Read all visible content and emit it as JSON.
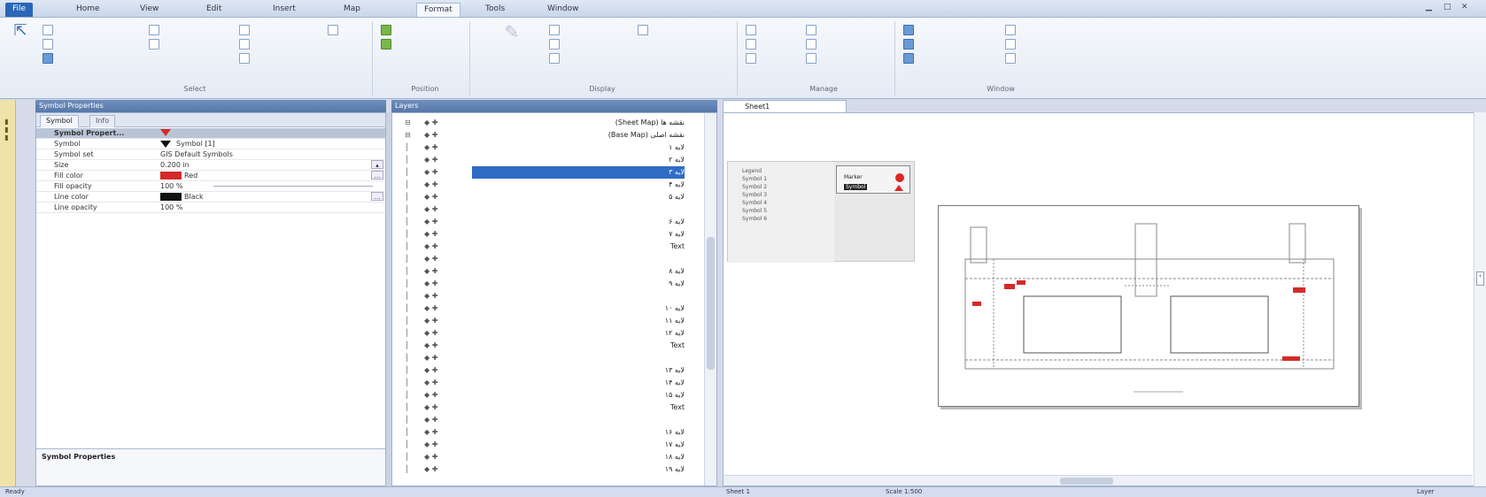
{
  "ribbon_tabs": [
    "File",
    "Home",
    "View",
    "Edit",
    "Insert",
    "Map",
    "Format",
    "Tools",
    "Window"
  ],
  "ribbon": {
    "groups": [
      "Select",
      "Position",
      "Display",
      "Manage",
      "Window"
    ]
  },
  "property_panel": {
    "title": "Symbol Properties",
    "tabs": [
      "Symbol",
      "Info"
    ],
    "rows_head": "Symbol Propert...",
    "rows": [
      {
        "k": "Symbol",
        "v": "Symbol [1]"
      },
      {
        "k": "Symbol set",
        "v": "GIS Default Symbols"
      },
      {
        "k": "Size",
        "v": "0.200 in"
      },
      {
        "k": "Fill color",
        "v": "Red"
      },
      {
        "k": "Fill opacity",
        "v": "100 %"
      },
      {
        "k": "Line color",
        "v": "Black"
      },
      {
        "k": "Line opacity",
        "v": "100 %"
      }
    ],
    "description": "Symbol Properties"
  },
  "tree_panel": {
    "title": "Layers",
    "items": [
      "نقشه ها (Sheet Map)",
      "نقشه اصلی (Base Map)",
      "لایه ۱",
      "لایه ۲",
      "لایه ۳",
      "لایه ۴",
      "لایه ۵",
      "",
      "لایه ۶",
      "لایه ۷",
      "Text",
      "",
      "لایه ۸",
      "لایه ۹",
      "",
      "لایه ۱۰",
      "لایه ۱۱",
      "لایه ۱۲",
      "Text",
      "",
      "لایه ۱۳",
      "لایه ۱۴",
      "لایه ۱۵",
      "Text",
      "",
      "لایه ۱۶",
      "لایه ۱۷",
      "لایه ۱۸",
      "لایه ۱۹"
    ],
    "selected_index": 4
  },
  "document": {
    "tab": "Sheet1",
    "legend_lines": [
      "Legend",
      "Symbol 1",
      "Symbol 2",
      "Symbol 3",
      "Symbol 4",
      "Symbol 5",
      "Symbol 6"
    ],
    "legend_box": {
      "label_a": "Marker",
      "label_b": "Symbol"
    }
  },
  "statusbar": {
    "left": "Ready",
    "mid1": "Sheet 1",
    "mid2": "Scale 1:500",
    "right": "Layer"
  },
  "colors": {
    "fill": "#d42a2a",
    "line": "#111111",
    "selection": "#2f6cc5",
    "accent": "#2a66b7"
  }
}
